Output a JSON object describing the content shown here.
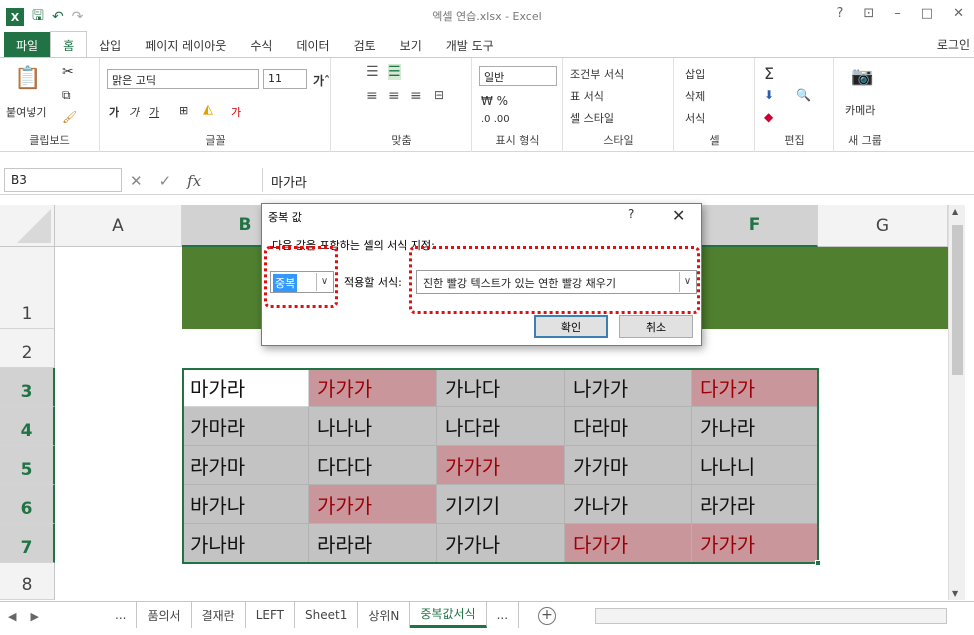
{
  "window": {
    "title": "엑셀 연습.xlsx - Excel",
    "controls": [
      "?",
      "⊡",
      "–",
      "□",
      "✕"
    ]
  },
  "ribbon_tabs": [
    "파일",
    "홈",
    "삽입",
    "페이지 레이아웃",
    "수식",
    "데이터",
    "검토",
    "보기",
    "개발 도구"
  ],
  "login": "로그인",
  "ribbon": {
    "clipboard": {
      "paste": "붙여넣기",
      "label": "클립보드"
    },
    "font": {
      "name": "맑은 고딕",
      "size": "11",
      "label": "글꼴"
    },
    "alignment": {
      "label": "맞춤"
    },
    "number": {
      "format": "일반",
      "label": "표시 형식"
    },
    "styles": {
      "cond": "조건부 서식",
      "table": "표 서식",
      "cell": "셀 스타일",
      "label": "스타일"
    },
    "cells": {
      "insert": "삽입",
      "delete": "삭제",
      "format": "서식",
      "label": "셀"
    },
    "editing": {
      "label": "편집"
    },
    "newgroup": {
      "camera": "카메라",
      "label": "새 그룹"
    }
  },
  "formula_bar": {
    "name_box": "B3",
    "value": "마가라"
  },
  "columns": [
    "A",
    "B",
    "C",
    "D",
    "E",
    "F",
    "G"
  ],
  "rows": [
    "1",
    "2",
    "3",
    "4",
    "5",
    "6",
    "7",
    "8"
  ],
  "table": [
    [
      "마가라",
      "가가가",
      "가나다",
      "나가가",
      "다가가"
    ],
    [
      "가마라",
      "나나나",
      "나다라",
      "다라마",
      "가나라"
    ],
    [
      "라가마",
      "다다다",
      "가가가",
      "가가마",
      "나나니"
    ],
    [
      "바가나",
      "가가가",
      "기기기",
      "가나가",
      "라가라"
    ],
    [
      "가나바",
      "라라라",
      "가가나",
      "다가가",
      "가가가"
    ]
  ],
  "duplicates": [
    [
      0,
      1
    ],
    [
      0,
      4
    ],
    [
      2,
      2
    ],
    [
      3,
      1
    ],
    [
      4,
      3
    ],
    [
      4,
      4
    ]
  ],
  "dialog": {
    "title": "중복 값",
    "help": "?",
    "close": "✕",
    "prompt": "다음 값을 포함하는 셀의 서식 지정:",
    "type_value": "중복",
    "apply_label": "적용할 서식:",
    "format_value": "진한 빨강 텍스트가 있는 연한 빨강 채우기",
    "ok": "확인",
    "cancel": "취소"
  },
  "sheet_tabs": [
    "...",
    "품의서",
    "결재란",
    "LEFT",
    "Sheet1",
    "상위N",
    "중복값서식",
    "..."
  ],
  "active_sheet": "중복값서식",
  "colors": {
    "excel_green": "#217346",
    "header_fill": "#4f7f2f",
    "dup_fill": "#c9979b",
    "dup_text": "#9c0006",
    "gray_fill": "#c3c3c3"
  }
}
